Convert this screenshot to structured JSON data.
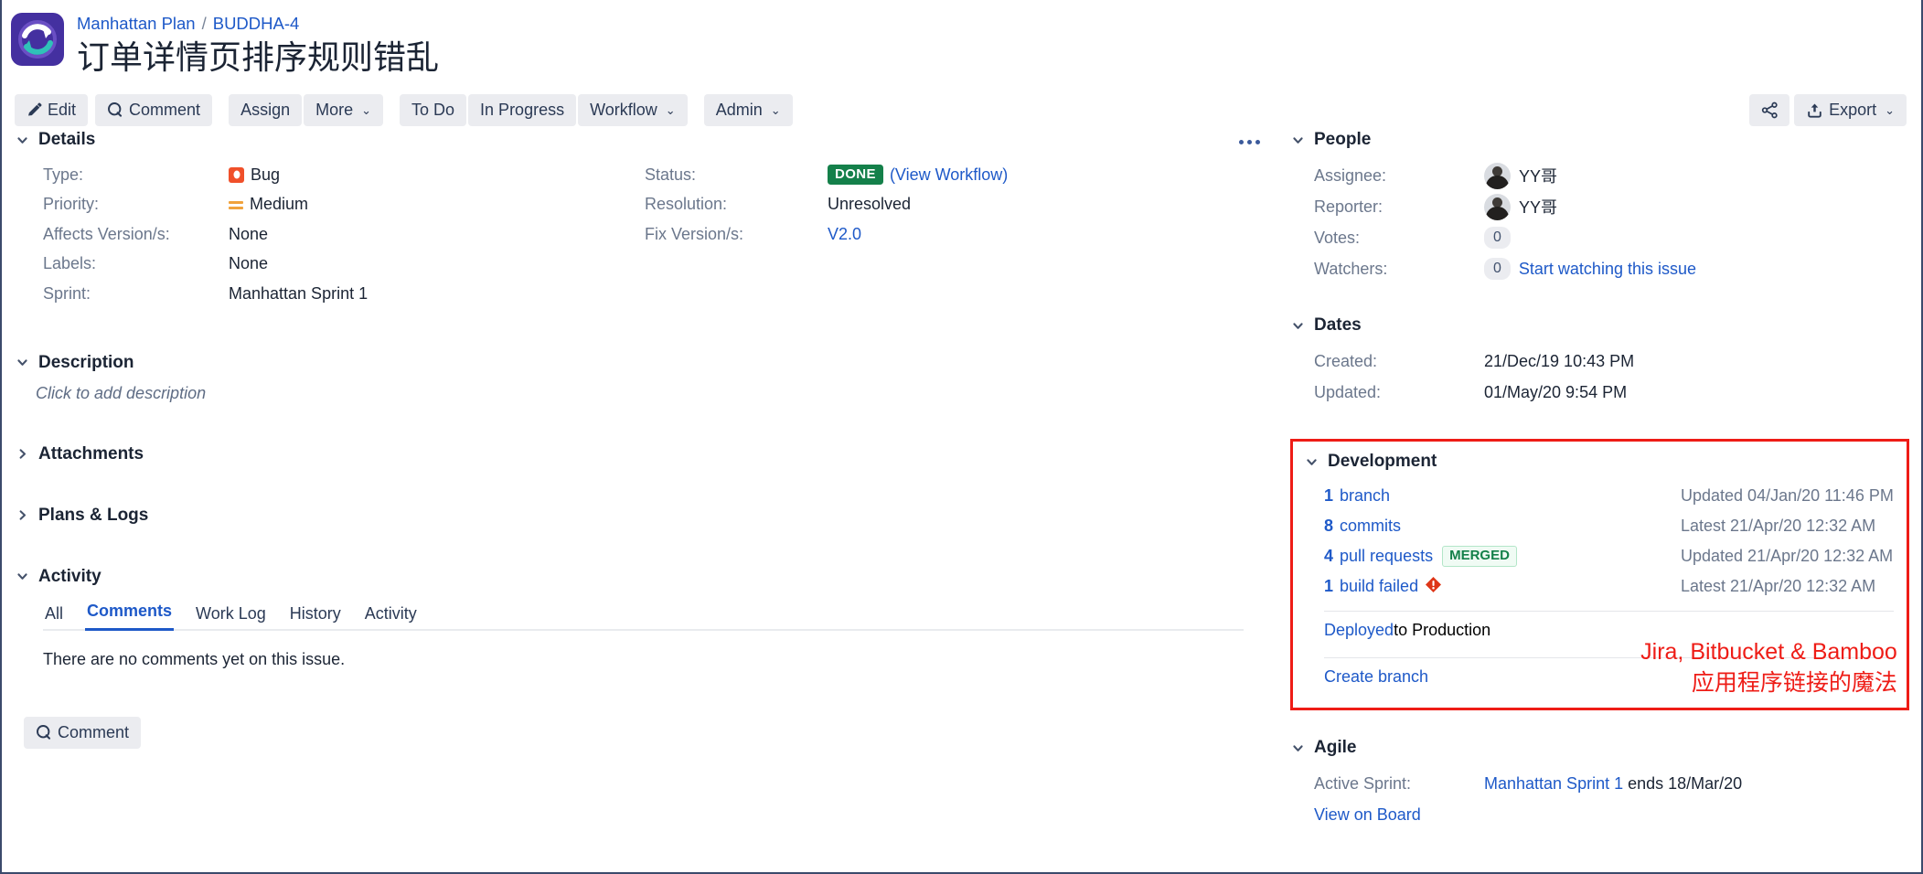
{
  "header": {
    "logo_icon": "sync-arrows-icon",
    "breadcrumb_project": "Manhattan Plan",
    "breadcrumb_sep": "/",
    "breadcrumb_issue_key": "BUDDHA-4",
    "issue_title": "订单详情页排序规则错乱"
  },
  "toolbar": {
    "edit_label": "Edit",
    "comment_label": "Comment",
    "assign_label": "Assign",
    "more_label": "More",
    "todo_label": "To Do",
    "in_progress_label": "In Progress",
    "workflow_label": "Workflow",
    "admin_label": "Admin",
    "export_label": "Export",
    "share_icon": "share-icon",
    "export_icon": "export-upload-icon",
    "caret": "⌄"
  },
  "details": {
    "title": "Details",
    "left_fields": [
      {
        "label": "Type:",
        "value": "Bug",
        "icon": "bug-icon"
      },
      {
        "label": "Priority:",
        "value": "Medium",
        "icon": "priority-medium-icon"
      },
      {
        "label": "Affects Version/s:",
        "value": "None"
      },
      {
        "label": "Labels:",
        "value": "None"
      },
      {
        "label": "Sprint:",
        "value": "Manhattan Sprint 1"
      }
    ],
    "right_fields": [
      {
        "label": "Status:",
        "badge": "DONE",
        "link": "(View Workflow)"
      },
      {
        "label": "Resolution:",
        "value": "Unresolved"
      },
      {
        "label": "Fix Version/s:",
        "link_value": "V2.0"
      }
    ]
  },
  "description": {
    "title": "Description",
    "placeholder": "Click to add description"
  },
  "attachments": {
    "title": "Attachments"
  },
  "plans_logs": {
    "title": "Plans & Logs"
  },
  "activity": {
    "title": "Activity",
    "tabs": [
      {
        "label": "All",
        "active": false
      },
      {
        "label": "Comments",
        "active": true
      },
      {
        "label": "Work Log",
        "active": false
      },
      {
        "label": "History",
        "active": false
      },
      {
        "label": "Activity",
        "active": false
      }
    ],
    "empty_message": "There are no comments yet on this issue.",
    "comment_button": "Comment"
  },
  "people": {
    "title": "People",
    "assignee_label": "Assignee:",
    "assignee_name": "YY哥",
    "reporter_label": "Reporter:",
    "reporter_name": "YY哥",
    "votes_label": "Votes:",
    "votes_count": "0",
    "watchers_label": "Watchers:",
    "watchers_count": "0",
    "watch_link": "Start watching this issue"
  },
  "dates": {
    "title": "Dates",
    "created_label": "Created:",
    "created_value": "21/Dec/19 10:43 PM",
    "updated_label": "Updated:",
    "updated_value": "01/May/20 9:54 PM"
  },
  "development": {
    "title": "Development",
    "rows": [
      {
        "count": "1",
        "label": "branch",
        "meta": "Updated 04/Jan/20 11:46 PM"
      },
      {
        "count": "8",
        "label": "commits",
        "meta": "Latest 21/Apr/20 12:32 AM"
      },
      {
        "count": "4",
        "label": "pull requests",
        "badge": "MERGED",
        "meta": "Updated 21/Apr/20 12:32 AM"
      },
      {
        "count": "1",
        "label": "build failed",
        "icon": "build-failed-icon",
        "meta": "Latest 21/Apr/20 12:32 AM"
      }
    ],
    "deployed_link": "Deployed",
    "deployed_rest": " to Production",
    "create_branch": "Create branch",
    "annotation_line1": "Jira, Bitbucket & Bamboo",
    "annotation_line2": "应用程序链接的魔法",
    "highlight_color": "#ee1c16"
  },
  "agile": {
    "title": "Agile",
    "active_sprint_label": "Active Sprint:",
    "active_sprint_link": "Manhattan Sprint 1",
    "active_sprint_rest": " ends 18/Mar/20",
    "view_on_board": "View on Board"
  },
  "colors": {
    "link": "#1e59c8",
    "muted": "#6b778c",
    "status_done": "#14804a",
    "bug": "#f0502a",
    "priority": "#f0a23c",
    "logo_bg": "#4430a0"
  }
}
